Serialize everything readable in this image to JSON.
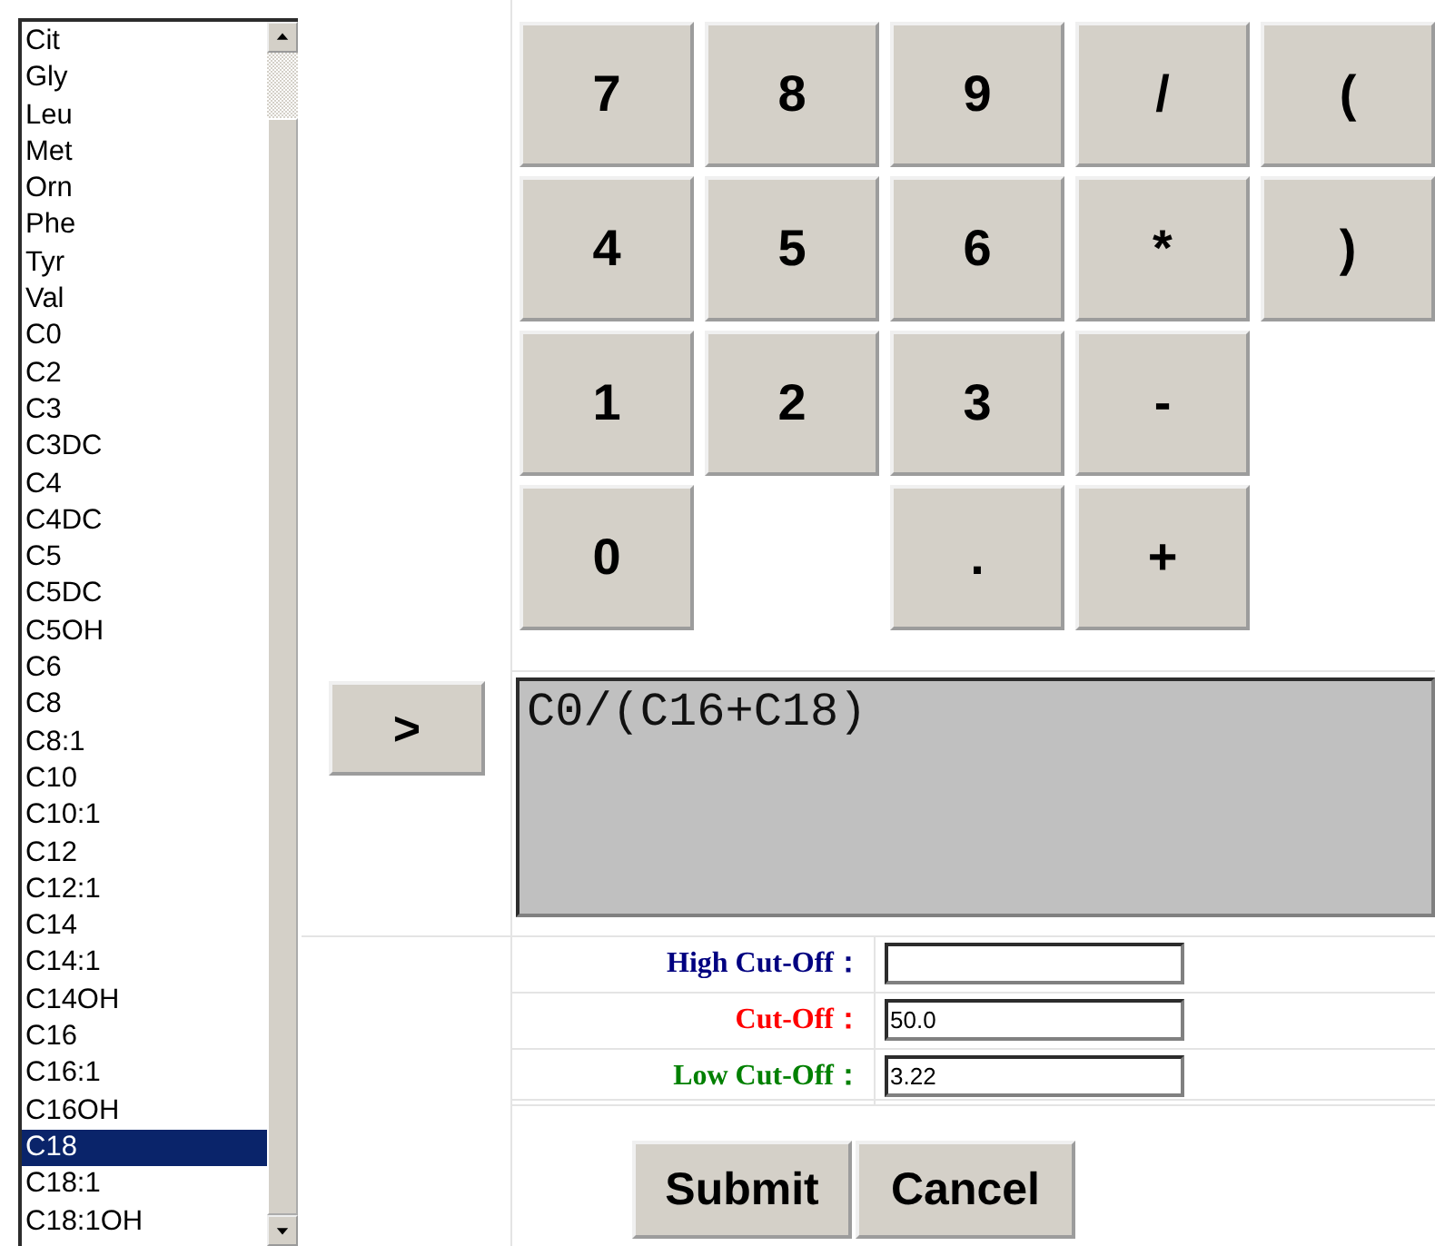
{
  "analyte_list": [
    {
      "label": "Cit",
      "selected": false
    },
    {
      "label": "Gly",
      "selected": false
    },
    {
      "label": "Leu",
      "selected": false
    },
    {
      "label": "Met",
      "selected": false
    },
    {
      "label": "Orn",
      "selected": false
    },
    {
      "label": "Phe",
      "selected": false
    },
    {
      "label": "Tyr",
      "selected": false
    },
    {
      "label": "Val",
      "selected": false
    },
    {
      "label": "C0",
      "selected": false
    },
    {
      "label": "C2",
      "selected": false
    },
    {
      "label": "C3",
      "selected": false
    },
    {
      "label": "C3DC",
      "selected": false
    },
    {
      "label": "C4",
      "selected": false
    },
    {
      "label": "C4DC",
      "selected": false
    },
    {
      "label": "C5",
      "selected": false
    },
    {
      "label": "C5DC",
      "selected": false
    },
    {
      "label": "C5OH",
      "selected": false
    },
    {
      "label": "C6",
      "selected": false
    },
    {
      "label": "C8",
      "selected": false
    },
    {
      "label": "C8:1",
      "selected": false
    },
    {
      "label": "C10",
      "selected": false
    },
    {
      "label": "C10:1",
      "selected": false
    },
    {
      "label": "C12",
      "selected": false
    },
    {
      "label": "C12:1",
      "selected": false
    },
    {
      "label": "C14",
      "selected": false
    },
    {
      "label": "C14:1",
      "selected": false
    },
    {
      "label": "C14OH",
      "selected": false
    },
    {
      "label": "C16",
      "selected": false
    },
    {
      "label": "C16:1",
      "selected": false
    },
    {
      "label": "C16OH",
      "selected": false
    },
    {
      "label": "C18",
      "selected": true
    },
    {
      "label": "C18:1",
      "selected": false
    },
    {
      "label": "C18:1OH",
      "selected": false
    }
  ],
  "keypad": [
    [
      {
        "kind": "key",
        "label": "7"
      },
      {
        "kind": "key",
        "label": "8"
      },
      {
        "kind": "key",
        "label": "9"
      },
      {
        "kind": "key",
        "label": "/"
      },
      {
        "kind": "key",
        "label": "("
      }
    ],
    [
      {
        "kind": "key",
        "label": "4"
      },
      {
        "kind": "key",
        "label": "5"
      },
      {
        "kind": "key",
        "label": "6"
      },
      {
        "kind": "key",
        "label": "*"
      },
      {
        "kind": "key",
        "label": ")"
      }
    ],
    [
      {
        "kind": "key",
        "label": "1"
      },
      {
        "kind": "key",
        "label": "2"
      },
      {
        "kind": "key",
        "label": "3"
      },
      {
        "kind": "key",
        "label": "-"
      }
    ],
    [
      {
        "kind": "key",
        "label": "0"
      },
      {
        "kind": "gap"
      },
      {
        "kind": "key",
        "label": "."
      },
      {
        "kind": "key",
        "label": "+"
      }
    ]
  ],
  "insert_button": ">",
  "formula": "C0/(C16+C18)",
  "cutoffs": [
    {
      "label": "High Cut-Off：",
      "color": "#000080"
    },
    {
      "label": "Cut-Off：",
      "color": "#ff0000",
      "value": "50.0"
    },
    {
      "label": "Low Cut-Off：",
      "color": "#008000",
      "value": "3.22"
    }
  ],
  "buttons": [
    "Submit",
    "Cancel"
  ]
}
